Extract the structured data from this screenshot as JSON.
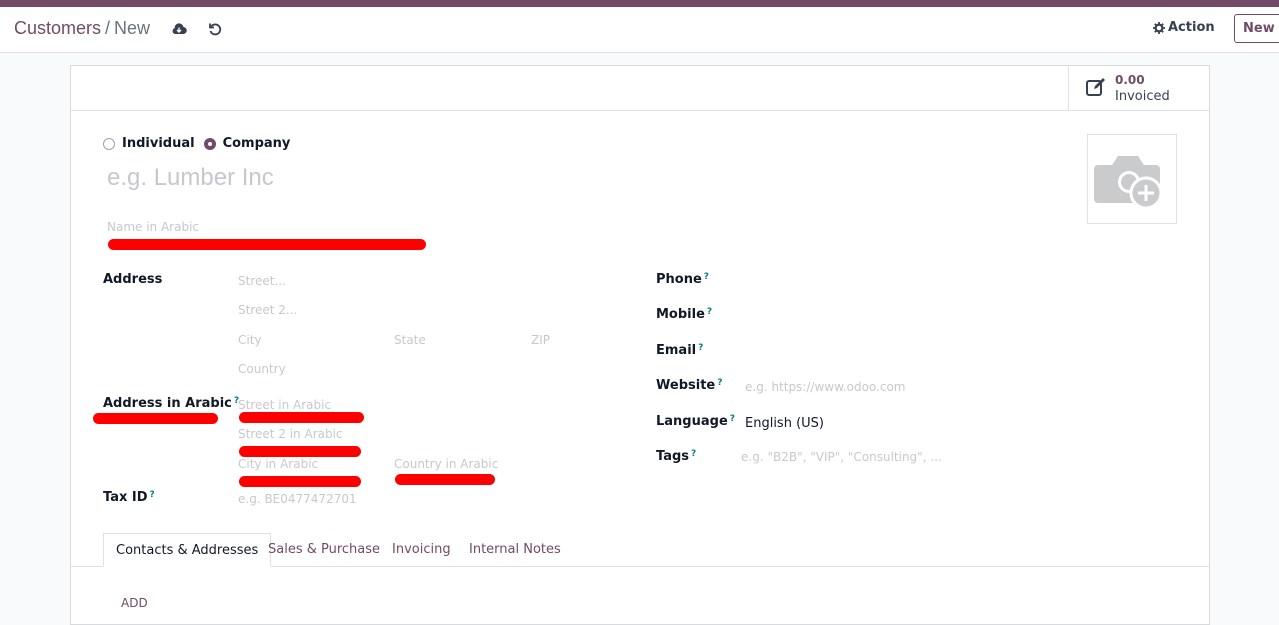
{
  "breadcrumb": {
    "parent": "Customers",
    "separator": "/",
    "current": "New"
  },
  "toolbar": {
    "action_label": "Action",
    "new_label": "New"
  },
  "stat": {
    "value": "0.00",
    "label": "Invoiced"
  },
  "company_type": {
    "options": [
      "Individual",
      "Company"
    ],
    "selected": "Company"
  },
  "name_placeholder": "e.g. Lumber Inc",
  "arabic_name_placeholder": "Name in Arabic",
  "address": {
    "label": "Address",
    "street": "Street...",
    "street2": "Street 2...",
    "city": "City",
    "state": "State",
    "zip": "ZIP",
    "country": "Country"
  },
  "address_arabic": {
    "label": "Address in Arabic",
    "street": "Street in Arabic",
    "street2": "Street 2 in Arabic",
    "city": "City in Arabic",
    "country": "Country in Arabic"
  },
  "tax": {
    "label": "Tax ID",
    "placeholder": "e.g. BE0477472701"
  },
  "contact": {
    "phone_label": "Phone",
    "mobile_label": "Mobile",
    "email_label": "Email",
    "website_label": "Website",
    "website_placeholder": "e.g. https://www.odoo.com",
    "language_label": "Language",
    "language_value": "English (US)",
    "tags_label": "Tags",
    "tags_placeholder": "e.g. \"B2B\", \"VIP\", \"Consulting\", ..."
  },
  "help_mark": "?",
  "tabs": [
    "Contacts & Addresses",
    "Sales & Purchase",
    "Invoicing",
    "Internal Notes"
  ],
  "add_label": "ADD",
  "colors": {
    "brand": "#714b67",
    "help": "#017e84",
    "redaction": "#ff0000"
  }
}
